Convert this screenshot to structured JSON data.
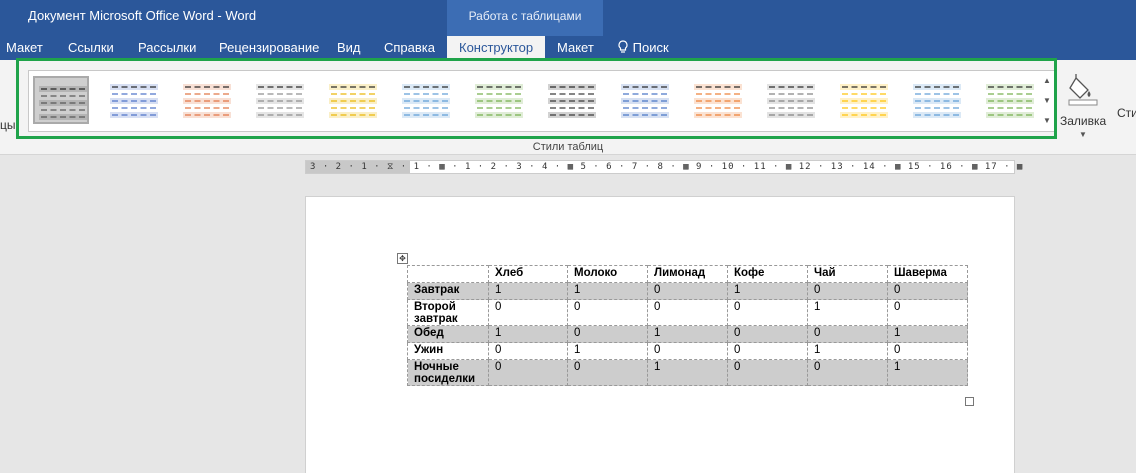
{
  "window": {
    "title": "Документ Microsoft Office Word  -  Word",
    "context_group": "Работа с таблицами"
  },
  "tabs": [
    {
      "label": "Макет",
      "active": false
    },
    {
      "label": "Ссылки",
      "active": false
    },
    {
      "label": "Рассылки",
      "active": false
    },
    {
      "label": "Рецензирование",
      "active": false
    },
    {
      "label": "Вид",
      "active": false
    },
    {
      "label": "Справка",
      "active": false
    },
    {
      "label": "Конструктор",
      "active": true
    },
    {
      "label": "Макет",
      "active": false
    },
    {
      "label": "Поиск",
      "active": false
    }
  ],
  "ribbon": {
    "left_cut_text": "цы",
    "group_label": "Стили таблиц",
    "fill_label": "Заливка",
    "right_cut_text": "Сти",
    "styles": [
      {
        "color": "#555555",
        "selected": true
      },
      {
        "color": "#4a6fc7",
        "selected": false
      },
      {
        "color": "#e07040",
        "selected": false
      },
      {
        "color": "#8a8a8a",
        "selected": false
      },
      {
        "color": "#e8b400",
        "selected": false
      },
      {
        "color": "#5b9bd5",
        "selected": false
      },
      {
        "color": "#70ad47",
        "selected": false
      },
      {
        "color": "#333333",
        "selected": false
      },
      {
        "color": "#4472c4",
        "selected": false
      },
      {
        "color": "#ed7d31",
        "selected": false
      },
      {
        "color": "#7f7f7f",
        "selected": false
      },
      {
        "color": "#ffc000",
        "selected": false
      },
      {
        "color": "#5b9bd5",
        "selected": false
      },
      {
        "color": "#70ad47",
        "selected": false
      }
    ],
    "accent": "#1fa34a"
  },
  "ruler": {
    "text": "3 · 2 · 1 · ⧖ · 1 · ▦ · 1 · 2 · 3 · 4 · ▦ 5 · 6 · 7 · 8 · ▦ 9 · 10 · 11 · ▦ 12 · 13 · 14 · ▦ 15 · 16 · ▦ 17 · ▦"
  },
  "table": {
    "headers": [
      "",
      "Хлеб",
      "Молоко",
      "Лимонад",
      "Кофе",
      "Чай",
      "Шаверма"
    ],
    "rows": [
      {
        "label": "Завтрак",
        "values": [
          "1",
          "1",
          "0",
          "1",
          "0",
          "0"
        ],
        "shaded": true
      },
      {
        "label": "Второй завтрак",
        "values": [
          "0",
          "0",
          "0",
          "0",
          "1",
          "0"
        ],
        "shaded": false
      },
      {
        "label": "Обед",
        "values": [
          "1",
          "0",
          "1",
          "0",
          "0",
          "1"
        ],
        "shaded": true
      },
      {
        "label": "Ужин",
        "values": [
          "0",
          "1",
          "0",
          "0",
          "1",
          "0"
        ],
        "shaded": false
      },
      {
        "label": "Ночные посиделки",
        "values": [
          "0",
          "0",
          "1",
          "0",
          "0",
          "1"
        ],
        "shaded": true
      }
    ]
  }
}
